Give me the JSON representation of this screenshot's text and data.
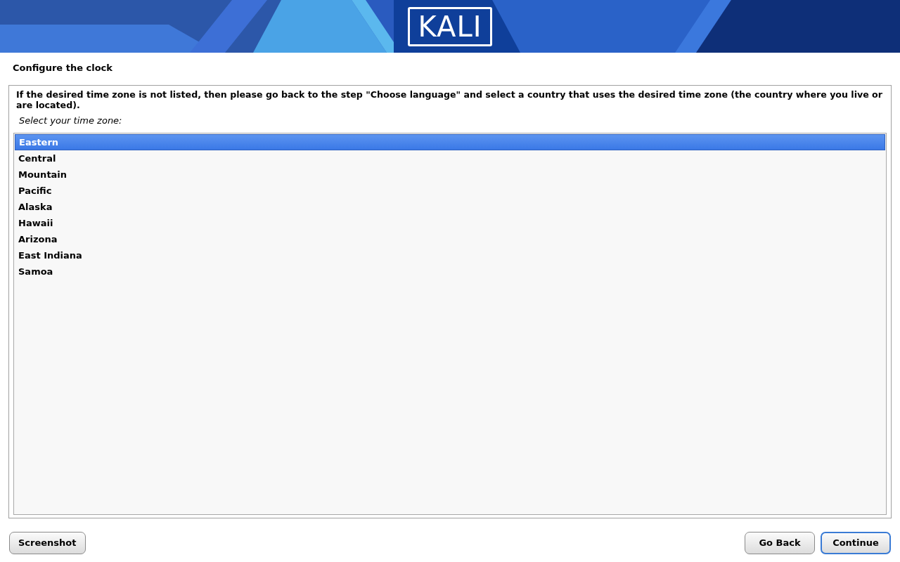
{
  "header": {
    "logo": "KALI"
  },
  "title": "Configure the clock",
  "instructions": "If the desired time zone is not listed, then please go back to the step \"Choose language\" and select a country that uses the desired time zone (the country where you live or are located).",
  "prompt": "Select your time zone:",
  "timezones": [
    {
      "label": "Eastern",
      "selected": true
    },
    {
      "label": "Central",
      "selected": false
    },
    {
      "label": "Mountain",
      "selected": false
    },
    {
      "label": "Pacific",
      "selected": false
    },
    {
      "label": "Alaska",
      "selected": false
    },
    {
      "label": "Hawaii",
      "selected": false
    },
    {
      "label": "Arizona",
      "selected": false
    },
    {
      "label": "East Indiana",
      "selected": false
    },
    {
      "label": "Samoa",
      "selected": false
    }
  ],
  "left_buttons": [
    {
      "label": "Screenshot",
      "focused": false
    }
  ],
  "right_buttons": [
    {
      "label": "Go Back",
      "focused": false
    },
    {
      "label": "Continue",
      "focused": true
    }
  ]
}
